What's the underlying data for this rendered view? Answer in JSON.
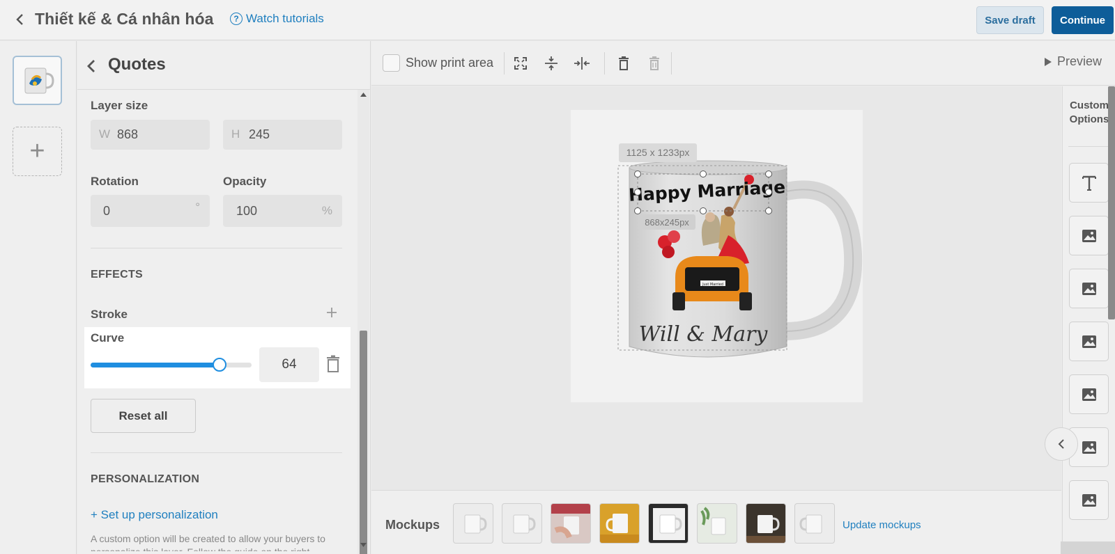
{
  "header": {
    "title": "Thiết kế & Cá nhân hóa",
    "tutorial_label": "Watch tutorials",
    "save_draft_label": "Save draft",
    "continue_label": "Continue"
  },
  "panel": {
    "title": "Quotes",
    "layer_size": {
      "label": "Layer size",
      "w_prefix": "W",
      "w_value": "868",
      "h_prefix": "H",
      "h_value": "245"
    },
    "rotation": {
      "label": "Rotation",
      "value": "0",
      "unit": "°"
    },
    "opacity": {
      "label": "Opacity",
      "value": "100",
      "unit": "%"
    },
    "effects_header": "EFFECTS",
    "stroke_label": "Stroke",
    "stroke_add_icon": "plus-icon",
    "curve": {
      "label": "Curve",
      "value": "64",
      "slider_fraction": 0.8
    },
    "reset_label": "Reset all",
    "personalization_header": "PERSONALIZATION",
    "setup_link": "+ Set up personalization",
    "help_text": "A custom option will be created to allow your buyers to personalize this layer. Follow the guide on the right"
  },
  "toolbar": {
    "show_print_label": "Show print area",
    "icons": [
      "fit-icon",
      "align-vertical-center-icon",
      "align-horizontal-center-icon",
      "trash-icon",
      "trash-disabled-icon"
    ],
    "preview_label": "Preview"
  },
  "canvas": {
    "image_size_label": "1125 x 1233px",
    "layer_size_label": "868x245px",
    "mug_text_top": "Happy Marriage",
    "mug_text_bottom": "Will & Mary",
    "plate_text": "Just Married"
  },
  "right_rail": {
    "title_line1": "Custom",
    "title_line2": "Options",
    "options": [
      "text-icon",
      "image-icon",
      "image-icon",
      "image-icon",
      "image-icon",
      "image-icon",
      "image-icon"
    ]
  },
  "mockups": {
    "label": "Mockups",
    "update_label": "Update mockups",
    "thumbs": [
      "plain-white",
      "plain-white",
      "hand-hold",
      "yellow-bg",
      "dark-frame",
      "plant",
      "dark-wood",
      "plain-white"
    ]
  },
  "colors": {
    "accent": "#1f8ee0",
    "link": "#1f7fbf",
    "primary_button": "#0e5d99",
    "car_orange": "#e8891a",
    "heart_red": "#d8212b"
  }
}
